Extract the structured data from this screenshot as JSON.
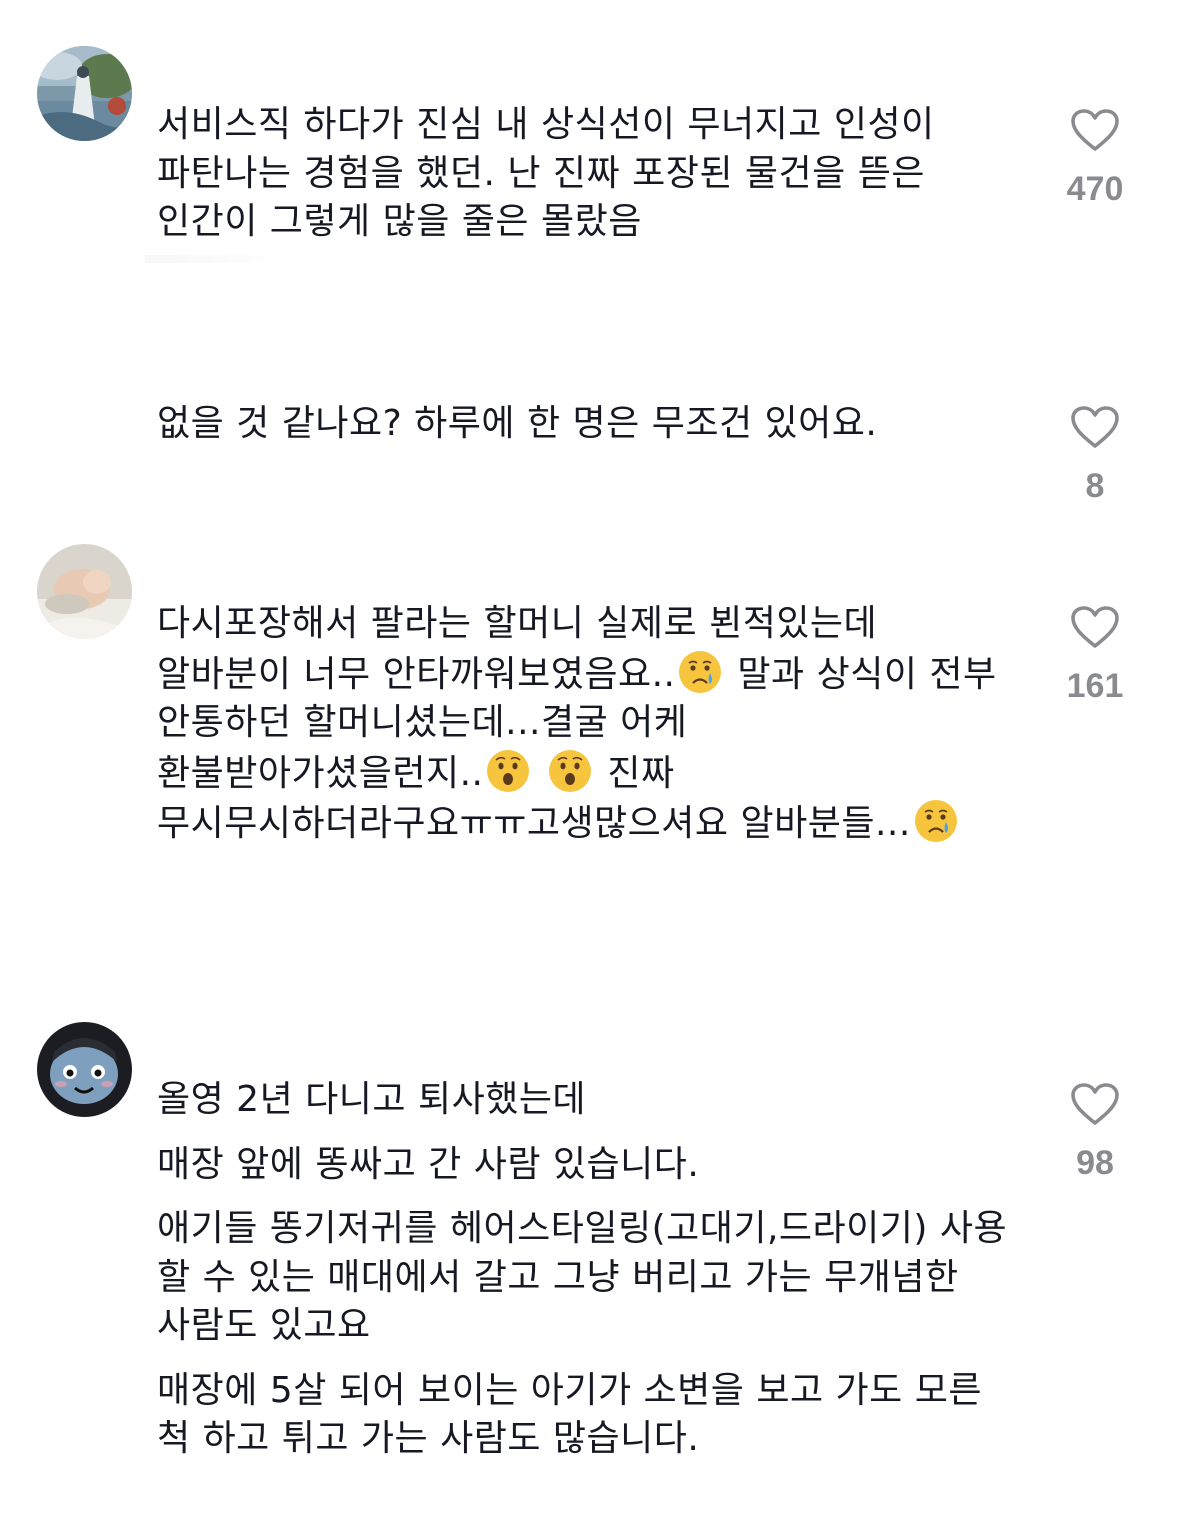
{
  "comments": [
    {
      "avatar": "landscape-painting-avatar",
      "paragraphs": [
        "서비스직 하다가 진심 내 상식선이 무너지고 인성이 파탄나는 경험을 했던. 난 진짜 포장된 물건을 뜯은 인간이 그렇게 많을 줄은 몰랐음"
      ],
      "likes": "470"
    },
    {
      "avatar": null,
      "paragraphs": [
        "없을 것 같나요? 하루에 한 명은 무조건 있어요."
      ],
      "likes": "8"
    },
    {
      "avatar": "baby-hand-avatar",
      "segments": [
        {
          "type": "text",
          "value": "다시포장해서 팔라는 할머니 실제로 뵌적있는데 알바분이 너무 안타까워보였음요.."
        },
        {
          "type": "emoji",
          "name": "crying-face-emoji"
        },
        {
          "type": "text",
          "value": " 말과 상식이 전부 안통하던 할머니셨는데...결굴 어케 환불받아가셨을런지.."
        },
        {
          "type": "emoji",
          "name": "surprised-face-emoji"
        },
        {
          "type": "text",
          "value": " "
        },
        {
          "type": "emoji",
          "name": "surprised-face-emoji"
        },
        {
          "type": "text",
          "value": " 진짜 무시무시하더라구요ㅠㅠ고생많으셔요 알바분들..."
        },
        {
          "type": "emoji",
          "name": "crying-face-emoji"
        }
      ],
      "likes": "161"
    },
    {
      "avatar": "cartoon-face-avatar",
      "paragraphs": [
        "올영 2년 다니고 퇴사했는데",
        "매장 앞에 똥싸고 간 사람 있습니다.",
        "애기들 똥기저귀를 헤어스타일링(고대기,드라이기) 사용 할 수 있는 매대에서 갈고 그냥 버리고 가는 무개념한 사람도 있고요",
        "매장에 5살 되어 보이는 아기가 소변을 보고 가도 모른 척 하고 튀고 가는 사람도 많습니다."
      ],
      "likes": "98"
    }
  ],
  "colors": {
    "text": "#161823",
    "like_count": "#8a8b91",
    "heart_outline": "#8a8b91"
  }
}
